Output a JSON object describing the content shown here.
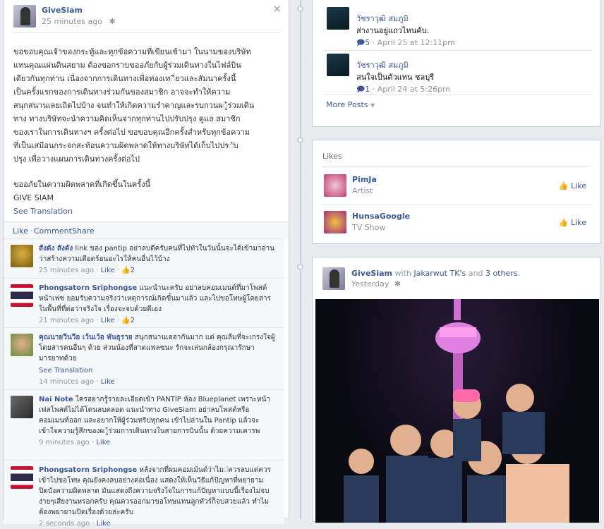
{
  "post": {
    "page_name": "GiveSiam",
    "time": "25 minutes ago",
    "body_lines": [
      "ขอขอบคุณเจ้าของกระทู้และทุกข้อความที่เขียนเข้ามา ในนามของบริษัท",
      "แทนคุณแผ่นดินสยาม ต้องขอกราบขออภัยกับผู้ร่วมเดินทางในไฟล์บิน",
      "เดียวกันทุกท่าน เนื่องจากการเดินทางเพื่อท่องเท◌ี่ยวและสัมนาครั้งนี้",
      "เป็นครั้งแรกของการเดินทางร่วมกันของสมาชิก อาจจะทำให้ความ",
      "สนุกสนานเลยเถิดไปบ้าง จนทำให้เกิดความรำคาญและรบกวนผ◌ู้ร่วมเดิน",
      "ทาง ทางบริษัทจะนำความคิดเห็นจากทุกท่านไปปรับปรุง ดูแล สมาชิก",
      "ของเราในการเดินทางฯ ครั้งต่อไป ขอขอบคุณอีกครั้งสำหรับทุกข้อความ",
      "ที่เป็นเสมือนกระจกสะท้อนความผิดพลาดให้ทางบริษัทได้เก็บไปปร◌ับ",
      "ปรุง เพื่อวางแผนการเดินทางครั้งต่อไป"
    ],
    "apology": "ขออภัยในความผิดพลาดที่เกิดขึ้นในครั้งนี้",
    "signature": "GIVE SIAM",
    "see_translation": "See Translation",
    "actions": {
      "like": "Like",
      "comment": "Comment",
      "share": "Share"
    }
  },
  "comments": [
    {
      "name": "สังดัง สังดัง",
      "text": "link ของ pantip อย่าลบดีครับคนที่ไปทัวในวันนั้นจะได้เข้ามาอ่าน ว่าสร้างความเดือดร้อนอะไรให้คนอื่นไว้บ้าง",
      "time": "25 minutes ago",
      "like": "Like",
      "likes": "2"
    },
    {
      "name": "Phongsatorn Sriphongse",
      "text": "แนะนำนะครับ อย่าลบคอมเมนต์ที่มาโพสต์หน้าเฟซ ยอมรับความจริงว่าเหตุการณ์เกิดขึ้นมาแล้ว และไปขอโทษผู้โดยสารในพื้นที่ที่ต่อว่าจริงใจ เรื่องจะจบด้วยดีเอง",
      "time": "21 minutes ago",
      "like": "Like",
      "likes": "2"
    },
    {
      "name": "คุณนายวีนวีอ เว้นเว้อ พันธุราย",
      "text": "สนุกสนานเฮฮากันมาก แต่ คุณลืมที่จะเกรงใจผู้โดยสารคนอื่นๆ ด้วย ส่วนน้องที่สาดแฟลชนะ รักจะเล่นกล้องกรุณารักษามารยาทด้วย",
      "see_translation": "See Translation",
      "time": "14 minutes ago",
      "like": "Like"
    },
    {
      "name": "Nai Note",
      "text": "ใครอยากรู้รายละเอียดเข้า PANTIP ห้อง Blueplanet เพราะหน้าเฟสโพสต์ไม่ได้โดนลบตลอด แนะนำทาง GiveSiam อย่าลบโพสต์หรือคอมเมนท์ออก และอยากให้ผู้ร่วมทริปทุกคน เข้าไปอ่านใน Pantip แล้วจะเข้าใจความรู้สึกของผ◌ู้ร่วมการเดินทางในสายการบินนั้น ด้วยความเคารพ",
      "time": "9 minutes ago",
      "like": "Like"
    },
    {
      "name": "Phongsatorn Sriphongse",
      "text": "หลังจากที่ผมคอมเม้นต์ว่าไม◌่ควรลบแต่ควรเข้าไปขอโทษ คุณยังคงลบอย่างต่อเนื่อง แสดงให้เห็นวิธีแก้ปัญหาที่พยายามปิดบังความผิดพลาด มันแสดงถึงความจริงใจในการแก้ปัญหาแบบนี้เรื่องไม่จบง่ายๆเสียงานหรอกครับ คุณควรออกมาขอโทษแทนลูกทัวร์ก็จบสวยแล้ว ทำไมต้องพยายามปิดเรื่องด้วยล่ะครับ",
      "time": "2 seconds ago",
      "like": "Like"
    }
  ],
  "right_comments": [
    {
      "name": "วัชราวุฒิ สมภูมิ",
      "text": "ส่างานอยู่แถวไหนคับ.",
      "replies": "5",
      "time": "April 25 at 12:11pm"
    },
    {
      "name": "วัชราวุฒิ สมภูมิ",
      "text": "สนใจเป็นตัวแทน ชลบุรี",
      "replies": "1",
      "time": "April 24 at 5:26pm"
    }
  ],
  "more_posts": "More Posts",
  "likes_box": {
    "title": "Likes",
    "items": [
      {
        "name": "PimJa",
        "category": "Artist",
        "like": "Like"
      },
      {
        "name": "HunsaGoogle",
        "category": "TV Show",
        "like": "Like"
      }
    ]
  },
  "photo_post": {
    "page_name": "GiveSiam",
    "with_text": "with",
    "tagged": "Jakarwut TK's",
    "and_text": "and",
    "others": "3 others.",
    "time": "Yesterday"
  },
  "colors": {
    "link": "#3b5998",
    "meta": "#90949c",
    "border": "#c4cde0"
  }
}
